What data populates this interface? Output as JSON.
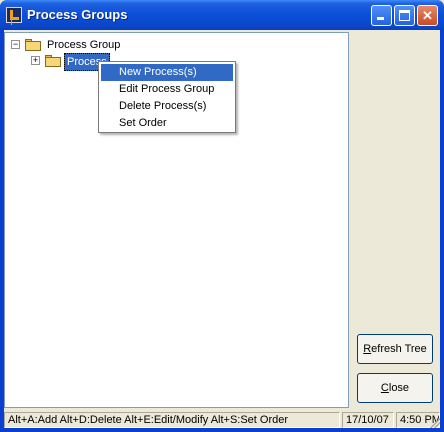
{
  "window": {
    "title": "Process Groups"
  },
  "tree": {
    "root": {
      "label": "Process Group",
      "expander": "⊟"
    },
    "child": {
      "label": "Process",
      "expander": "⊞"
    }
  },
  "context_menu": {
    "items": [
      {
        "label": "New Process(s)",
        "highlighted": true
      },
      {
        "label": "Edit Process Group",
        "highlighted": false
      },
      {
        "label": "Delete Process(s)",
        "highlighted": false
      },
      {
        "label": "Set Order",
        "highlighted": false
      }
    ]
  },
  "buttons": {
    "refresh_mnemonic": "R",
    "refresh_rest": "efresh Tree",
    "close_mnemonic": "C",
    "close_rest": "lose"
  },
  "status_bar": {
    "shortcuts": "Alt+A:Add   Alt+D:Delete   Alt+E:Edit/Modify   Alt+S:Set Order",
    "date": "17/10/07",
    "time": "4:50 PM"
  },
  "colors": {
    "title_bar": "#0b4fd8",
    "selection": "#316ac5",
    "face": "#ece9d8"
  }
}
